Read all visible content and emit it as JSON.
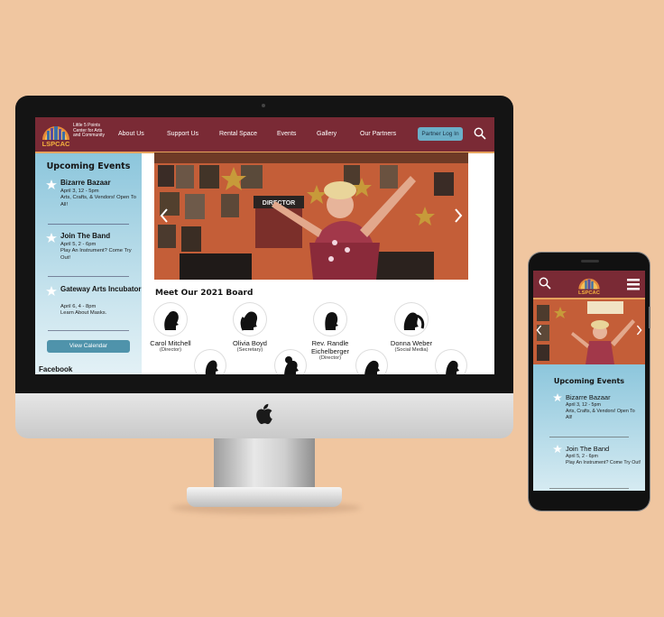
{
  "site": {
    "logo_text": "LSPCAC",
    "logo_tagline": "Little 5 Points Center for Arts and Community",
    "nav": [
      "About Us",
      "Support Us",
      "Rental Space",
      "Events",
      "Gallery",
      "Our Partners"
    ],
    "partner_button": "Partner Log In",
    "upcoming_title": "Upcoming Events",
    "events": [
      {
        "title": "Bizarre Bazaar",
        "date": "April 3, 12 - 5pm",
        "desc": "Arts, Crafts, & Vendors! Open To All!"
      },
      {
        "title": "Join The Band",
        "date": "April 5, 2 - 6pm",
        "desc": "Play An Instrument? Come Try Out!"
      },
      {
        "title": "Gateway Arts Incubator",
        "date": "April 6, 4 - 8pm",
        "desc": "Learn About Masks."
      }
    ],
    "view_calendar": "View Calendar",
    "facebook": "Facebook",
    "board_title": "Meet Our 2021 Board",
    "board": [
      {
        "name": "Carol Mitchell",
        "role": "(Director)"
      },
      {
        "name": "Olivia Boyd",
        "role": "(Secretary)"
      },
      {
        "name": "Rev. Randle Eichelberger",
        "role": "(Director)"
      },
      {
        "name": "Donna Weber",
        "role": "(Social Media)"
      }
    ],
    "hero_sign": "DIRECTOR",
    "slide_count": 5,
    "active_slide": 1
  },
  "phone": {
    "logo_text": "LSPCAC",
    "upcoming_title": "Upcoming Events",
    "events": [
      {
        "title": "Bizarre Bazaar",
        "date": "April 3, 12 - 5pm",
        "desc": "Arts, Crafts, & Vendors! Open To All!"
      },
      {
        "title": "Join The Band",
        "date": "April 5, 2 - 6pm",
        "desc": "Play An Instrument? Come Try Out!"
      }
    ]
  },
  "colors": {
    "header": "#7a2a35",
    "accent_orange": "#e6a35d",
    "button_blue": "#6bb0c8",
    "sidebar_top": "#8cc6dc",
    "background": "#f0c6a0"
  },
  "icons": [
    "search-icon",
    "star-icon",
    "chevron-left-icon",
    "chevron-right-icon",
    "hamburger-icon",
    "apple-logo-icon"
  ]
}
